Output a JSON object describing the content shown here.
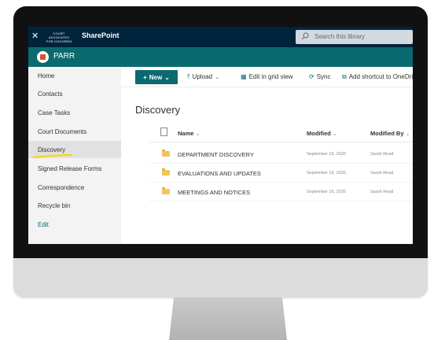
{
  "suite_bar": {
    "logo_text": "COURT ADVOCATES FOR CHILDREN",
    "app_name": "SharePoint",
    "search_placeholder": "Search this library"
  },
  "site": {
    "title": "PARR"
  },
  "left_nav": {
    "items": [
      "Home",
      "Contacts",
      "Case Tasks",
      "Court Documents",
      "Discovery",
      "Signed Release Forms",
      "Correspondence",
      "Recycle bin"
    ],
    "selected": "Discovery",
    "edit_label": "Edit"
  },
  "command_bar": {
    "new_label": "New",
    "upload_label": "Upload",
    "edit_grid_label": "Edit in grid view",
    "sync_label": "Sync",
    "add_shortcut_label": "Add shortcut to OneDrive"
  },
  "library": {
    "title": "Discovery",
    "columns": [
      "Name",
      "Modified",
      "Modified By"
    ],
    "rows": [
      {
        "name": "DEPARTMENT DISCOVERY",
        "modified": "September 16, 2020",
        "modified_by": "Sarah Read"
      },
      {
        "name": "EVALUATIONS AND UPDATES",
        "modified": "September 16, 2020",
        "modified_by": "Sarah Read"
      },
      {
        "name": "MEETINGS AND NOTICES",
        "modified": "September 16, 2020",
        "modified_by": "Sarah Read"
      }
    ]
  },
  "colors": {
    "suite_bar": "#00243c",
    "theme": "#0b6a6f",
    "folder": "#f2c45a",
    "highlight": "#f5d90a"
  }
}
